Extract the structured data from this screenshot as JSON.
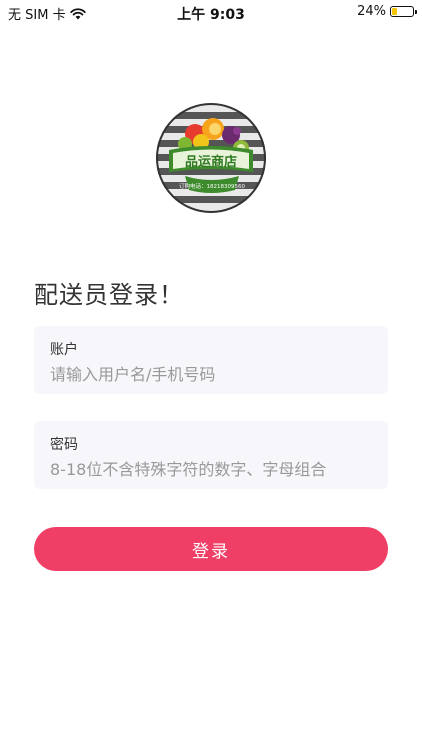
{
  "status_bar": {
    "carrier": "无 SIM 卡",
    "time": "上午 9:03",
    "battery_percent": "24%",
    "battery_level": 0.24,
    "battery_color": "#f3c400",
    "wifi_icon": "wifi-icon"
  },
  "logo": {
    "brand_text": "品运商店",
    "phone_text": "订购电话：18218309560"
  },
  "page": {
    "title": "配送员登录！"
  },
  "account_field": {
    "label": "账户",
    "placeholder": "请输入用户名/手机号码",
    "value": ""
  },
  "password_field": {
    "label": "密码",
    "placeholder": "8-18位不含特殊字符的数字、字母组合",
    "value": ""
  },
  "login_button": {
    "label": "登录",
    "color": "#f03f67"
  }
}
